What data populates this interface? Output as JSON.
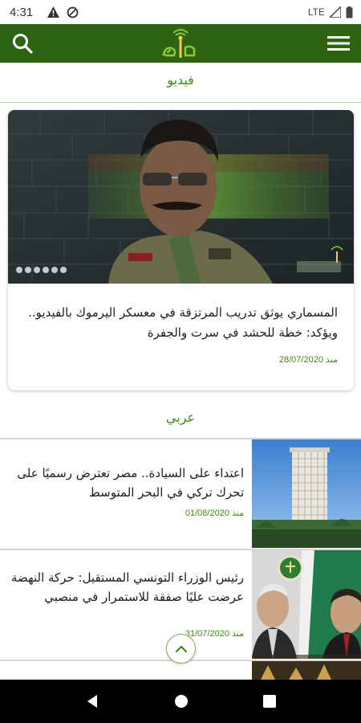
{
  "status_bar": {
    "time": "4:31",
    "network": "LTE"
  },
  "header": {
    "menu_icon": "hamburger-menu-icon",
    "search_icon": "search-icon",
    "brand_color": "#2e6411"
  },
  "sections": {
    "video_title": "فيديو",
    "arabic_title": "عربي"
  },
  "video_card": {
    "headline": "المسماري يوثق تدريب المرتزقة في معسكر اليرموك بالفيديو.. ويؤكد: خطة للحشد في سرت والجفرة",
    "date": "منذ 28/07/2020"
  },
  "articles": [
    {
      "headline": "اعتداء على السيادة.. مصر تعترض رسميًا على تحرك تركي في البحر المتوسط",
      "date": "منذ 01/08/2020"
    },
    {
      "headline": "رئيس الوزراء التونسي المستقيل: حركة النهضة عرضت عليًا صفقة للاستمرار في منصبي",
      "date": "منذ 31/07/2020"
    }
  ],
  "accent_color": "#3f8a17"
}
